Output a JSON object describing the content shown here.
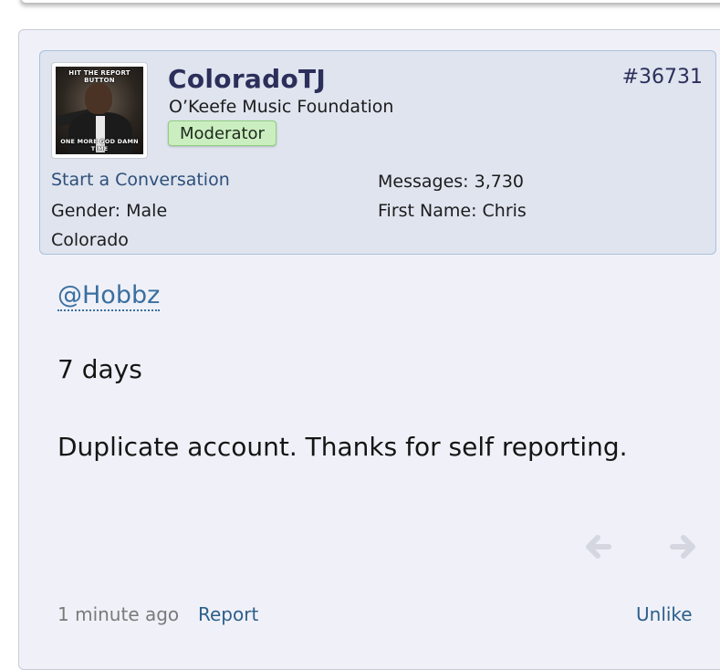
{
  "user": {
    "username": "ColoradoTJ",
    "title": "O’Keefe Music Foundation",
    "role_badge": "Moderator",
    "avatar_caption_top": "HIT THE REPORT BUTTON",
    "avatar_caption_bottom": "ONE MORE GOD DAMN TIME",
    "start_conversation": "Start a Conversation",
    "gender": "Gender:  Male",
    "location": "Colorado",
    "messages": "Messages:  3,730",
    "first_name": "First Name:  Chris"
  },
  "post": {
    "number": "#36731",
    "mention": "@Hobbz",
    "line1": "7 days",
    "line2": "Duplicate account. Thanks for self reporting.",
    "prev_icon": "arrow-left-icon",
    "next_icon": "arrow-right-icon"
  },
  "footer": {
    "time": "1 minute ago",
    "report": "Report",
    "unlike": "Unlike"
  }
}
